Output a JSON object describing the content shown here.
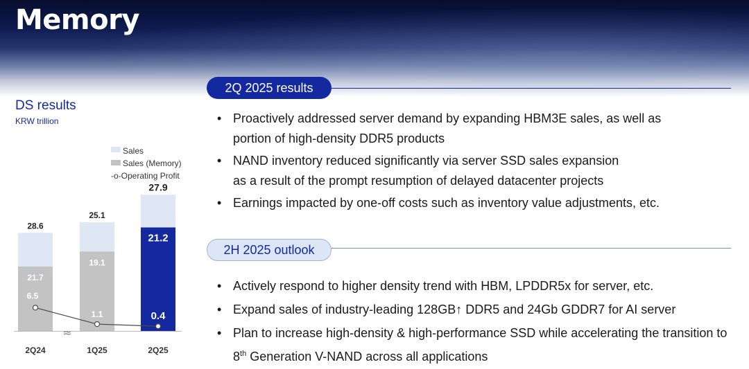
{
  "header": {
    "title": "Memory"
  },
  "ds": {
    "title": "DS results",
    "unit": "KRW trillion"
  },
  "chart_data": {
    "type": "bar",
    "categories": [
      "2Q24",
      "1Q25",
      "2Q25"
    ],
    "series": [
      {
        "name": "Sales",
        "values": [
          28.6,
          25.1,
          27.9
        ]
      },
      {
        "name": "Sales (Memory)",
        "values": [
          21.7,
          19.1,
          21.2
        ]
      },
      {
        "name": "Operating Profit",
        "values": [
          6.5,
          1.1,
          0.4
        ]
      }
    ],
    "labels": {
      "sales": [
        "28.6",
        "25.1",
        "27.9"
      ],
      "memory": [
        "21.7",
        "19.1",
        "21.2"
      ],
      "op": [
        "6.5",
        "1.1",
        "0.4"
      ]
    },
    "legend": [
      "Sales",
      "Sales (Memory)",
      "-o-Operating Profit"
    ],
    "axis_break": "≈",
    "colors": {
      "sales": "#dfe6f4",
      "memory": "#c3c3c3",
      "memory_highlight": "#1428a0",
      "op_line": "#4a4a4a"
    }
  },
  "results": {
    "pill": "2Q 2025 results",
    "bullets": [
      {
        "dot": "•",
        "line1": "Proactively addressed server demand by expanding HBM3E sales, as well as",
        "line2": "portion of high-density DDR5 products"
      },
      {
        "dot": "•",
        "line1": "NAND inventory reduced significantly via server SSD sales expansion",
        "line2": "as a result of the prompt resumption of delayed datacenter projects"
      },
      {
        "dot": "•",
        "line1": "Earnings impacted by one-off costs such as inventory value adjustments, etc."
      }
    ]
  },
  "outlook": {
    "pill": "2H 2025 outlook",
    "bullets": [
      {
        "dot": "•",
        "line1": "Actively respond to higher density trend with HBM, LPDDR5x for server, etc."
      },
      {
        "dot": "•",
        "line1": "Expand sales of industry-leading 128GB↑ DDR5 and 24Gb GDDR7 for AI server"
      },
      {
        "dot": "•",
        "line1": "Plan to increase high-density & high-performance SSD while accelerating the transition to",
        "line2_num": "8",
        "line2_sup": "th",
        "line2_rest": " Generation V-NAND across all applications"
      }
    ]
  }
}
